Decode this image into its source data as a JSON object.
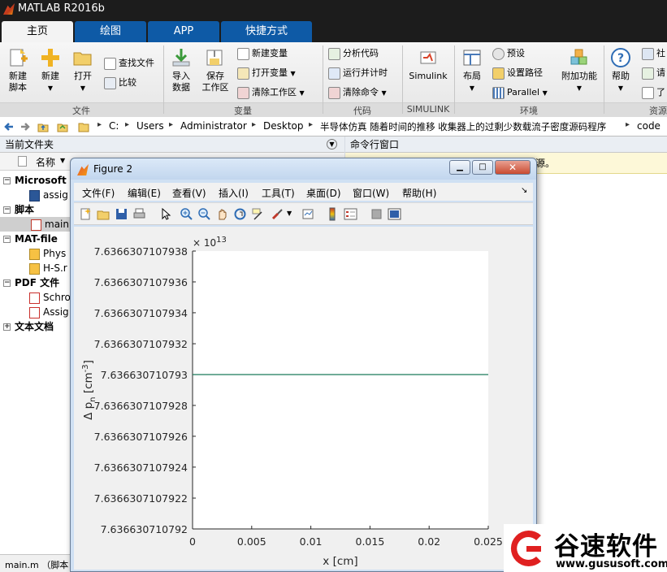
{
  "app": {
    "title": "MATLAB R2016b"
  },
  "ribbon_tabs": [
    {
      "label": "主页",
      "active": true
    },
    {
      "label": "绘图",
      "active": false
    },
    {
      "label": "APP",
      "active": false
    },
    {
      "label": "快捷方式",
      "active": false
    }
  ],
  "ribbon": {
    "new_script": {
      "line1": "新建",
      "line2": "脚本"
    },
    "new": "新建",
    "open": "打开",
    "find_files": "查找文件",
    "compare": "比较",
    "import": {
      "line1": "导入",
      "line2": "数据"
    },
    "save_ws": {
      "line1": "保存",
      "line2": "工作区"
    },
    "new_var": "新建变量",
    "open_var": "打开变量",
    "clear_ws": "清除工作区",
    "analyze_code": "分析代码",
    "run_time": "运行并计时",
    "clear_cmd": "清除命令",
    "simulink": "Simulink",
    "layout": "布局",
    "prefs": "预设",
    "set_path": "设置路径",
    "parallel": "Parallel",
    "addons": "附加功能",
    "help": "帮助",
    "community": "社",
    "request": "请",
    "learn": "了",
    "groups": {
      "file": "文件",
      "variable": "变量",
      "code": "代码",
      "simulink": "SIMULINK",
      "environment": "环境",
      "resources": "资源"
    }
  },
  "address": {
    "crumbs": [
      "C:",
      "Users",
      "Administrator",
      "Desktop",
      "半导体仿真 随着时间的推移 收集器上的过剩少数载流子密度源码程序",
      "code"
    ]
  },
  "current_folder": {
    "header": "当前文件夹",
    "col_name": "名称",
    "items": [
      {
        "label": "Microsoft V",
        "bold": true,
        "expander": "−"
      },
      {
        "label": "assig",
        "icon": "word"
      },
      {
        "label": "脚本",
        "bold": true,
        "expander": "−"
      },
      {
        "label": "main",
        "icon": "mfile",
        "selected": true
      },
      {
        "label": "MAT-file",
        "bold": true,
        "expander": "−"
      },
      {
        "label": "Phys",
        "icon": "mat"
      },
      {
        "label": "H-S.r",
        "icon": "mat"
      },
      {
        "label": "PDF 文件",
        "bold": true,
        "expander": "−"
      },
      {
        "label": "Schro",
        "icon": "pdf"
      },
      {
        "label": "Assig",
        "icon": "pdf"
      },
      {
        "label": "文本文档",
        "bold": true,
        "expander": "+"
      }
    ],
    "status": "main.m （脚本"
  },
  "command_window": {
    "header": "命令行窗口",
    "notice": "源。"
  },
  "figure": {
    "title": "Figure 2",
    "menu": [
      "文件(F)",
      "编辑(E)",
      "查看(V)",
      "插入(I)",
      "工具(T)",
      "桌面(D)",
      "窗口(W)",
      "帮助(H)"
    ],
    "tools": [
      "new-figure-icon",
      "open-file-icon",
      "save-icon",
      "print-icon",
      "pointer-icon",
      "zoom-in-icon",
      "zoom-out-icon",
      "pan-icon",
      "rotate-icon",
      "data-cursor-icon",
      "brush-icon",
      "link-plot-icon",
      "colorbar-icon",
      "legend-icon",
      "hide-plot-tools-icon",
      "show-plot-tools-icon"
    ]
  },
  "chart_data": {
    "type": "line",
    "xlabel": "x [cm]",
    "ylabel_main": "Δ p",
    "ylabel_sub": "n",
    "ylabel_unit_open": " [cm",
    "ylabel_unit_exp": "-3",
    "ylabel_unit_close": "]",
    "exponent_base": "× 10",
    "exponent_power": "13",
    "xlim": [
      0,
      0.025
    ],
    "ylim": [
      7.636630710792,
      7.6366307107938
    ],
    "xticks": [
      0,
      0.005,
      0.01,
      0.015,
      0.02,
      0.025
    ],
    "xtick_labels": [
      "0",
      "0.005",
      "0.01",
      "0.015",
      "0.02",
      "0.025"
    ],
    "yticks": [
      7.636630710792,
      7.6366307107922,
      7.6366307107924,
      7.6366307107926,
      7.6366307107928,
      7.636630710793,
      7.6366307107932,
      7.6366307107934,
      7.6366307107936,
      7.6366307107938
    ],
    "ytick_labels": [
      "7.636630710792",
      "7.6366307107922",
      "7.6366307107924",
      "7.6366307107926",
      "7.6366307107928",
      "7.636630710793",
      "7.6366307107932",
      "7.6366307107934",
      "7.6366307107936",
      "7.6366307107938"
    ],
    "series": [
      {
        "color": "#1b7a5a",
        "x": [
          0,
          0.025
        ],
        "y": [
          7.636630710793,
          7.636630710793
        ]
      }
    ]
  },
  "watermark": {
    "brand": "谷速软件",
    "url": "www.gususoft.com",
    "color": "#e02020"
  }
}
